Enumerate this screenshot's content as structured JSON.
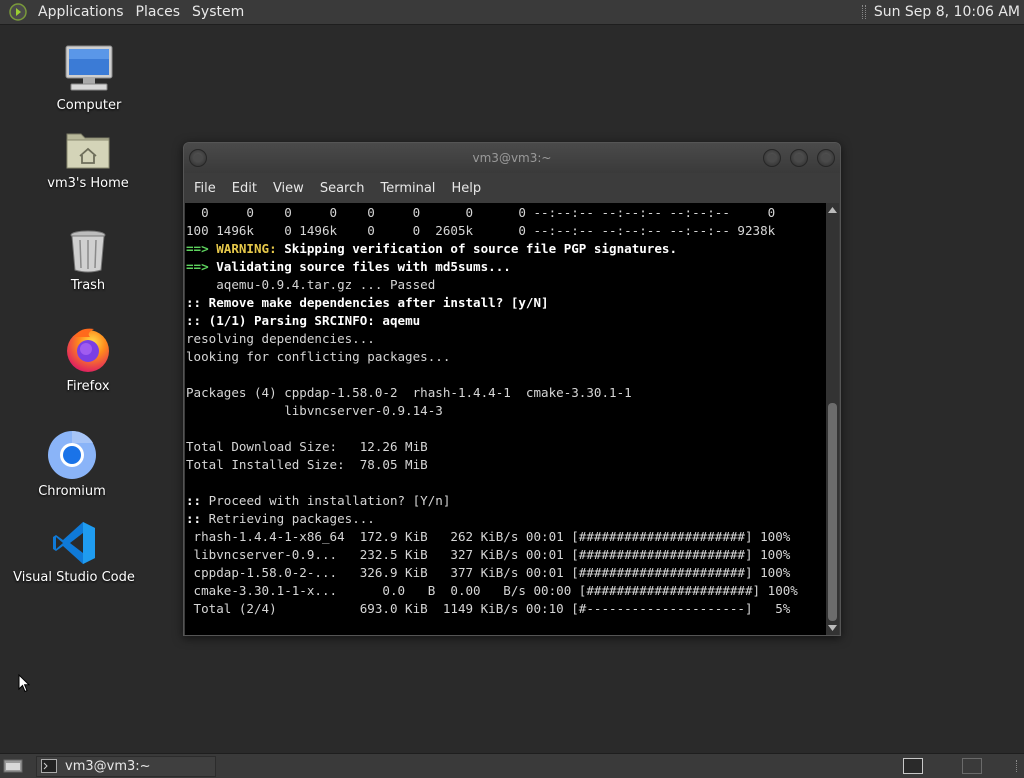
{
  "top_panel": {
    "menus": [
      "Applications",
      "Places",
      "System"
    ],
    "clock": "Sun Sep  8, 10:06 AM"
  },
  "desktop": {
    "icons": [
      {
        "label": "Computer",
        "icon": "computer-icon"
      },
      {
        "label": "vm3's Home",
        "icon": "home-folder-icon"
      },
      {
        "label": "Trash",
        "icon": "trash-icon"
      },
      {
        "label": "Firefox",
        "icon": "firefox-icon"
      },
      {
        "label": "Chromium",
        "icon": "chromium-icon"
      },
      {
        "label": "Visual Studio Code",
        "icon": "vscode-icon"
      }
    ]
  },
  "terminal": {
    "title": "vm3@vm3:~",
    "menu": [
      "File",
      "Edit",
      "View",
      "Search",
      "Terminal",
      "Help"
    ],
    "lines": [
      {
        "text": "  0     0    0     0    0     0      0      0 --:--:-- --:--:-- --:--:--     0"
      },
      {
        "text": "100 1496k    0 1496k    0     0  2605k      0 --:--:-- --:--:-- --:--:-- 9238k"
      },
      {
        "prefix": "==> ",
        "prefix_style": "green",
        "emph": "WARNING:",
        "emph_style": "yellow",
        "text": " Skipping verification of source file PGP signatures.",
        "style": "b"
      },
      {
        "prefix": "==> ",
        "prefix_style": "green",
        "text": "Validating source files with md5sums...",
        "style": "b"
      },
      {
        "text": "    aqemu-0.9.4.tar.gz ... Passed"
      },
      {
        "prefix": ":: ",
        "prefix_style": "b",
        "text": "Remove make dependencies after install? [y/N]",
        "style": "b"
      },
      {
        "prefix": ":: ",
        "prefix_style": "b",
        "text": "(1/1) Parsing SRCINFO: aqemu",
        "style": "b"
      },
      {
        "text": "resolving dependencies..."
      },
      {
        "text": "looking for conflicting packages..."
      },
      {
        "text": ""
      },
      {
        "text": "Packages (4) cppdap-1.58.0-2  rhash-1.4.4-1  cmake-3.30.1-1"
      },
      {
        "text": "             libvncserver-0.9.14-3"
      },
      {
        "text": ""
      },
      {
        "text": "Total Download Size:   12.26 MiB"
      },
      {
        "text": "Total Installed Size:  78.05 MiB"
      },
      {
        "text": ""
      },
      {
        "prefix": ":: ",
        "prefix_style": "b",
        "text": "Proceed with installation? [Y/n]"
      },
      {
        "prefix": ":: ",
        "prefix_style": "b",
        "text": "Retrieving packages..."
      },
      {
        "text": " rhash-1.4.4-1-x86_64  172.9 KiB   262 KiB/s 00:01 [######################] 100%"
      },
      {
        "text": " libvncserver-0.9...   232.5 KiB   327 KiB/s 00:01 [######################] 100%"
      },
      {
        "text": " cppdap-1.58.0-2-...   326.9 KiB   377 KiB/s 00:01 [######################] 100%"
      },
      {
        "text": " cmake-3.30.1-1-x...      0.0   B  0.00   B/s 00:00 [######################] 100%"
      },
      {
        "text": " Total (2/4)           693.0 KiB  1149 KiB/s 00:10 [#---------------------]   5%"
      }
    ]
  },
  "taskbar": {
    "window_button": "vm3@vm3:~"
  },
  "colors": {
    "desktop_bg": "#2a2a2a",
    "panel_bg": "#3a3a3a",
    "terminal_bg": "#000000",
    "prompt_green": "#5ed45e",
    "warning_yellow": "#e6c84a"
  }
}
